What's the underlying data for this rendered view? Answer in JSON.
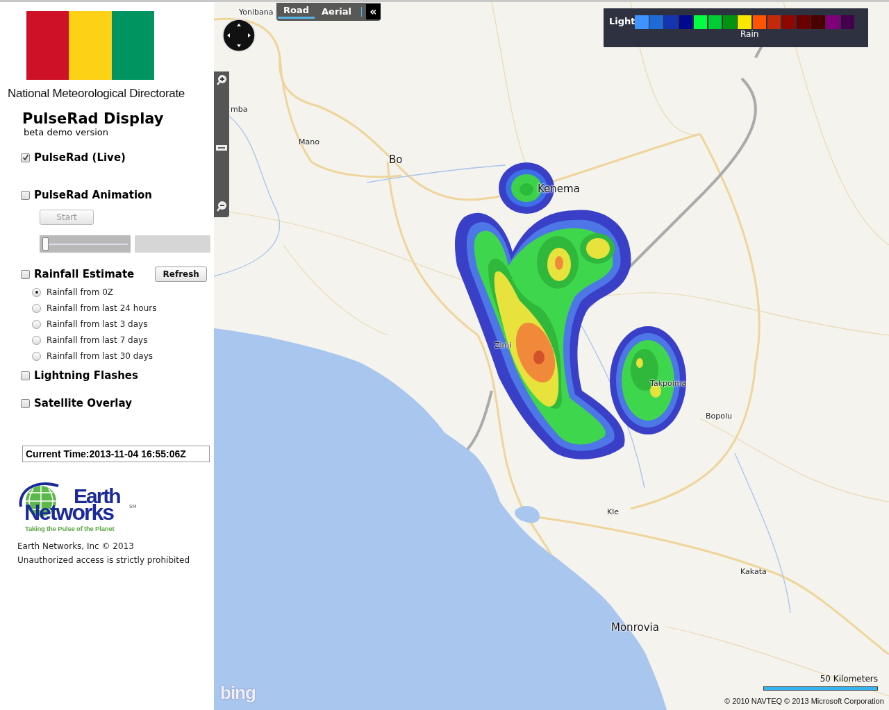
{
  "sidebar": {
    "organization": "National Meteorological Directorate",
    "title": "PulseRad Display",
    "subtitle": "beta demo version",
    "layers": [
      {
        "kind": "check",
        "label": "PulseRad (Live)",
        "checked": true
      },
      {
        "kind": "animation",
        "label": "PulseRad Animation",
        "checked": false,
        "button": "Start",
        "level": 0.02
      },
      {
        "kind": "rainfall",
        "label": "Rainfall Estimate",
        "checked": false,
        "button": "Refresh",
        "options": [
          {
            "label": "Rainfall from 0Z",
            "selected": true
          },
          {
            "label": "Rainfall from last 24 hours",
            "selected": false
          },
          {
            "label": "Rainfall from last 3 days",
            "selected": false
          },
          {
            "label": "Rainfall from last 7 days",
            "selected": false
          },
          {
            "label": "Rainfall from last 30 days",
            "selected": false
          }
        ]
      },
      {
        "kind": "check",
        "label": "Lightning Flashes",
        "checked": false
      },
      {
        "kind": "check",
        "label": "Satellite Overlay",
        "checked": false
      }
    ],
    "current_time": "Current Time:2013-11-04 16:55:06Z",
    "logo": {
      "line1": "Earth",
      "line2": "Networks",
      "mark": "SM",
      "tagline": "Taking the Pulse of the Planet"
    },
    "copyright": "Earth Networks, Inc © 2013",
    "notice": "Unauthorized access is strictly prohibited"
  },
  "map": {
    "map_types": [
      {
        "label": "Road",
        "selected": true
      },
      {
        "label": "Aerial",
        "selected": false
      }
    ],
    "collapse_button": "«",
    "legend": {
      "low_label": "Light",
      "caption": "Rain",
      "swatches": [
        {
          "color": "#3f94ff"
        },
        {
          "color": "#1f6ad6"
        },
        {
          "color": "#1535b0"
        },
        {
          "color": "#00088f"
        },
        {
          "color": "#00ff40"
        },
        {
          "color": "#00cc33"
        },
        {
          "color": "#009410"
        },
        {
          "color": "#f7e600"
        },
        {
          "color": "#ff5500"
        },
        {
          "color": "#c42a0a"
        },
        {
          "color": "#8f0800"
        },
        {
          "color": "#6b0000"
        },
        {
          "color": "#4a0000"
        },
        {
          "color": "#7f0079"
        },
        {
          "color": "#44004d"
        }
      ]
    },
    "places": [
      {
        "name": "Yonibana",
        "kind": "town"
      },
      {
        "name": "mba",
        "kind": "town"
      },
      {
        "name": "Mano",
        "kind": "town"
      },
      {
        "name": "Bo",
        "kind": "city"
      },
      {
        "name": "Kenema",
        "kind": "city"
      },
      {
        "name": "Zimi",
        "kind": "town"
      },
      {
        "name": "Takpoima",
        "kind": "town"
      },
      {
        "name": "Bopolu",
        "kind": "town"
      },
      {
        "name": "Kle",
        "kind": "town"
      },
      {
        "name": "Kakata",
        "kind": "town"
      },
      {
        "name": "Monrovia",
        "kind": "city"
      }
    ],
    "scale": "50 Kilometers",
    "provider_logo": "bing",
    "attributions": [
      "© 2010 NAVTEQ",
      "© 2013 Microsoft Corporation"
    ]
  }
}
